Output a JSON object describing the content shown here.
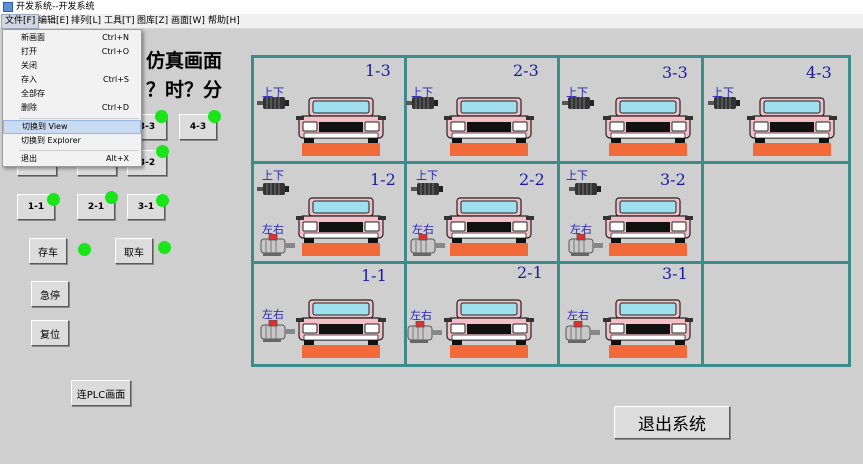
{
  "window": {
    "title": "开发系统--开发系统"
  },
  "menubar": [
    {
      "label": "文件[F]",
      "active": true
    },
    {
      "label": "编辑[E]"
    },
    {
      "label": "排列[L]"
    },
    {
      "label": "工具[T]"
    },
    {
      "label": "图库[Z]"
    },
    {
      "label": "画面[W]"
    },
    {
      "label": "帮助[H]"
    }
  ],
  "file_menu": [
    {
      "label": "新画面",
      "shortcut": "Ctrl+N"
    },
    {
      "label": "打开",
      "shortcut": "Ctrl+O"
    },
    {
      "label": "关闭",
      "shortcut": ""
    },
    {
      "label": "存入",
      "shortcut": "Ctrl+S"
    },
    {
      "label": "全部存",
      "shortcut": ""
    },
    {
      "label": "删除",
      "shortcut": "Ctrl+D"
    },
    {
      "label": "切换到  View",
      "shortcut": "",
      "selected": true
    },
    {
      "label": "切换到  Explorer",
      "shortcut": ""
    },
    {
      "label": "退出",
      "shortcut": "Alt+X"
    }
  ],
  "header": {
    "title_visible": "仿真画面",
    "time_visible": "？时？分"
  },
  "left_buttons": {
    "b43": "4-3",
    "b33": "3-3",
    "b32": "3-2",
    "b11": "1-1",
    "b21": "2-1",
    "b31": "3-1",
    "store": "存车",
    "retrieve": "取车",
    "estop": "急停",
    "reset": "复位",
    "plc": "连PLC画面"
  },
  "exit_button": "退出系统",
  "garage": {
    "up_down_label": "上下",
    "left_right_label": "左右",
    "slots": [
      {
        "label": "1-3"
      },
      {
        "label": "2-3"
      },
      {
        "label": "3-3"
      },
      {
        "label": "4-3"
      },
      {
        "label": "1-2"
      },
      {
        "label": "2-2"
      },
      {
        "label": "3-2"
      },
      {
        "label": "1-1"
      },
      {
        "label": "2-1"
      },
      {
        "label": "3-1"
      }
    ]
  },
  "colors": {
    "grid": "#3d8c8c",
    "indicator_on": "#18e618",
    "car_body": "#f3c0c8",
    "car_window": "#9fe0ee",
    "platform": "#f36a3a",
    "label_blue": "#1a1aa8"
  }
}
